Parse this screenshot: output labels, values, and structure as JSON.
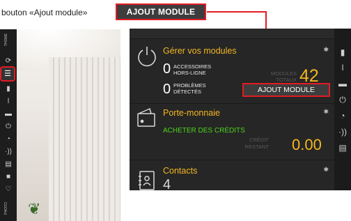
{
  "caption": {
    "text": "bouton «Ajout module»",
    "chip_label": "AJOUT MODULE"
  },
  "left_screen": {
    "sidebar_top_label": "THOME",
    "sidebar_bottom_label": "PHOTO",
    "icons": [
      "refresh-icon",
      "menu-icon",
      "lock-icon",
      "thermometer-icon",
      "folder-icon",
      "power-icon",
      "clock-icon",
      "signal-icon",
      "list-icon",
      "camera-icon",
      "heart-icon"
    ]
  },
  "app": {
    "modules": {
      "title": "Gérer vos modules",
      "accessories_count": "0",
      "accessories_label_1": "ACCESSOIRES",
      "accessories_label_2": "HORS-LIGNE",
      "problems_count": "0",
      "problems_label_1": "PROBLÈMES",
      "problems_label_2": "DÉTECTÉS",
      "total_label_1": "MODULES",
      "total_label_2": "TOTAUX",
      "total_value": "42",
      "add_button": "AJOUT MODULE"
    },
    "wallet": {
      "title": "Porte-monnaie",
      "buy_link": "ACHETER DES CRÉDITS",
      "credit_label_1": "CRÉDIT",
      "credit_label_2": "RESTANT",
      "credit_value": "0.00"
    },
    "contacts": {
      "title": "Contacts",
      "count": "4"
    },
    "right_rail_icons": [
      "lock-icon",
      "thermometer-icon",
      "folder-icon",
      "power-icon",
      "clock-icon",
      "signal-icon",
      "list-icon"
    ],
    "colors": {
      "accent_yellow": "#f2b722",
      "accent_green": "#4cd61c",
      "highlight_red": "#e31b23"
    }
  }
}
